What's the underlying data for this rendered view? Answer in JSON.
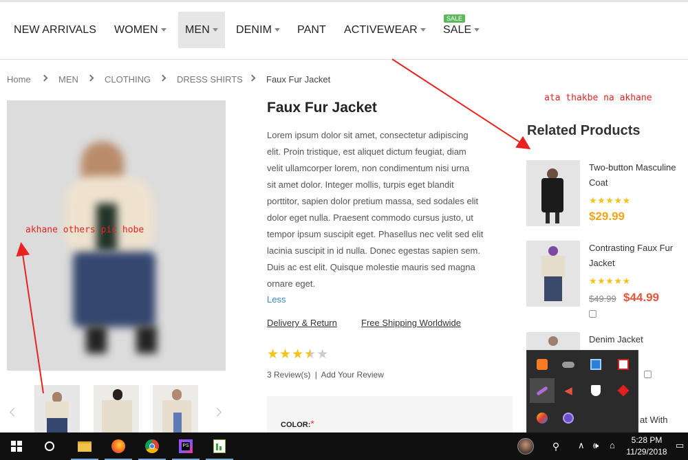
{
  "nav": {
    "items": [
      {
        "label": "NEW ARRIVALS",
        "dropdown": false
      },
      {
        "label": "WOMEN",
        "dropdown": true
      },
      {
        "label": "MEN",
        "dropdown": true,
        "active": true
      },
      {
        "label": "DENIM",
        "dropdown": true
      },
      {
        "label": "PANT",
        "dropdown": false
      },
      {
        "label": "ACTIVEWEAR",
        "dropdown": true
      },
      {
        "label": "SALE",
        "dropdown": true
      }
    ],
    "sale_badge": "SALE"
  },
  "breadcrumb": [
    "Home",
    "MEN",
    "CLOTHING",
    "DRESS SHIRTS",
    "Faux Fur Jacket"
  ],
  "product": {
    "title": "Faux Fur Jacket",
    "description_lines": [
      "Lorem ipsum dolor sit amet, consectetur adipiscing",
      "elit. Proin tristique, est aliquet dictum feugiat, diam",
      "velit ullamcorper lorem, non condimentum nisi urna",
      "sit amet dolor. Integer mollis, turpis eget blandit",
      "porttitor, sapien dolor pretium massa, sed sodales elit",
      "dolor eget nulla. Praesent commodo cursus justo, ut",
      "tempor ipsum suscipit eget. Phasellus nec velit sed elit",
      "lacinia suscipit in id nulla. Donec egestas sapien sem.",
      "Duis ac est elit. Quisque molestie mauris sed magna",
      "ornare eget."
    ],
    "less_label": "Less",
    "delivery_label": "Delivery & Return",
    "shipping_label": "Free Shipping Worldwide",
    "rating": 3.5,
    "reviews_label": "3 Review(s)",
    "review_sep": "|",
    "add_review_label": "Add Your Review",
    "color_label": "COLOR:",
    "required_mark": "*"
  },
  "annotations": {
    "top": "ata thakbe na akhane",
    "left": "akhane others pic hobe"
  },
  "related": {
    "title": "Related Products",
    "items": [
      {
        "name_lines": [
          "Two-button Masculine",
          "Coat"
        ],
        "stars": "★★★★★",
        "price": "$29.99"
      },
      {
        "name_lines": [
          "Contrasting Faux Fur",
          "Jacket"
        ],
        "stars": "★★★★★",
        "old_price": "$49.99",
        "price": "$44.99"
      },
      {
        "name_lines": [
          "Denim Jacket"
        ]
      },
      {
        "name_partial": "at With"
      }
    ]
  },
  "taskbar": {
    "time": "5:28 PM",
    "date": "11/29/2018"
  },
  "colors": {
    "accent_star": "#f2c31a",
    "price_orange": "#f2a41a",
    "price_sale": "#e2563c",
    "link_blue": "#3a87c8",
    "annotation_red": "#e8231f",
    "sale_green": "#5cb85c"
  }
}
